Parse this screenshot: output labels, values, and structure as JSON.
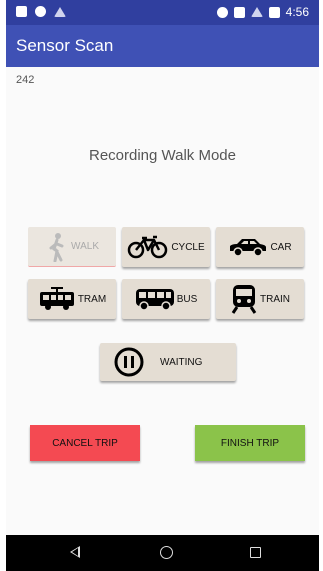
{
  "status_bar": {
    "time": "4:56"
  },
  "app_bar": {
    "title": "Sensor Scan"
  },
  "counter": "242",
  "mode_title": "Recording Walk Mode",
  "modes": {
    "walk": "WALK",
    "cycle": "CYCLE",
    "car": "CAR",
    "tram": "TRAM",
    "bus": "BUS",
    "train": "TRAIN"
  },
  "waiting_label": "WAITING",
  "cancel_label": "CANCEL TRIP",
  "finish_label": "FINISH TRIP",
  "colors": {
    "app_bar": "#3f51b5",
    "status_bar": "#303f9f",
    "cancel": "#f44a52",
    "finish": "#8bc34a",
    "button": "#e4ddd3"
  }
}
